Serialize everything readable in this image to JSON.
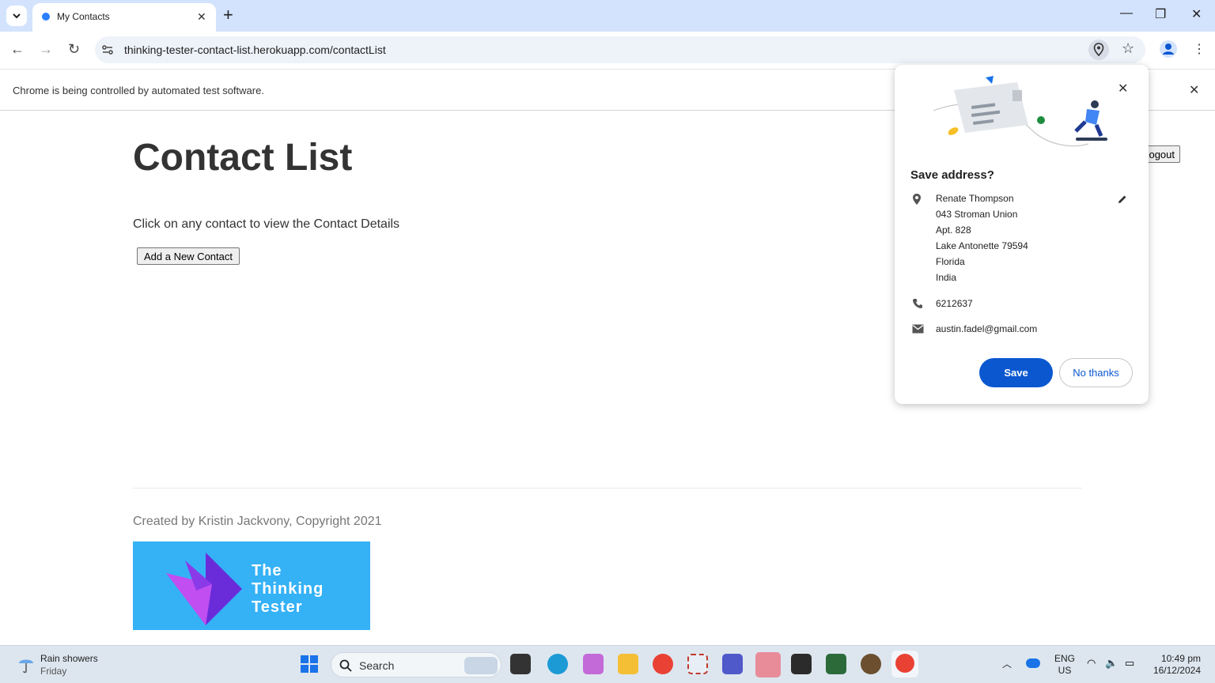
{
  "browser": {
    "tab_title": "My Contacts",
    "url": "thinking-tester-contact-list.herokuapp.com/contactList",
    "infobar_text": "Chrome is being controlled by automated test software."
  },
  "page": {
    "title": "Contact List",
    "instructions": "Click on any contact to view the Contact Details",
    "add_contact_label": "Add a New Contact",
    "logout_label": "Logout",
    "footer_text": "Created by Kristin Jackvony, Copyright 2021",
    "logo_words": [
      "The",
      "Thinking",
      "Tester"
    ]
  },
  "popup": {
    "title": "Save address?",
    "address_lines": [
      "Renate Thompson",
      "043 Stroman Union",
      "Apt. 828",
      "Lake Antonette 79594",
      "Florida",
      "India"
    ],
    "phone": "6212637",
    "email": "austin.fadel@gmail.com",
    "save_label": "Save",
    "no_thanks_label": "No thanks"
  },
  "taskbar": {
    "weather_title": "Rain showers",
    "weather_day": "Friday",
    "search_label": "Search",
    "lang_top": "ENG",
    "lang_bottom": "US",
    "time": "10:49 pm",
    "date": "16/12/2024"
  }
}
